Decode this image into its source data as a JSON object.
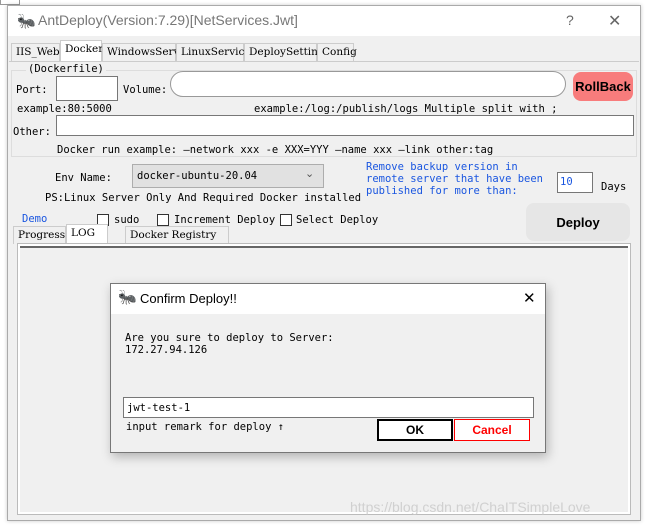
{
  "window": {
    "title": "AntDeploy(Version:7.29)[NetServices.Jwt]",
    "help": "?",
    "close": "✕"
  },
  "tabs": [
    "IIS_Web",
    "Docker",
    "WindowsService",
    "LinuxService",
    "DeploySetting",
    "Config"
  ],
  "dockerfile": {
    "group_label": "(Dockerfile)",
    "port_label": "Port:",
    "port_value": "",
    "volume_label": "Volume:",
    "volume_value": "",
    "port_example": "example:80:5000",
    "volume_example": "example:/log:/publish/logs  Multiple split with ;",
    "other_label": "Other:",
    "other_value": "",
    "run_example": "Docker run example: —network xxx -e XXX=YYY —name xxx —link other:tag"
  },
  "rollback_label": "RollBack",
  "rollback_color": "#f87c7c",
  "env": {
    "label": "Env Name:",
    "selected": "docker-ubuntu-20.04",
    "note": "PS:Linux Server Only And Required Docker installed"
  },
  "backup": {
    "text1": "Remove backup version in",
    "text2": "remote server that have been",
    "text3": "published for more than:",
    "days_value": "10",
    "days_label": "Days"
  },
  "options": {
    "demo": "Demo",
    "sudo": "sudo",
    "increment": "Increment Deploy",
    "select": "Select Deploy"
  },
  "deploy_label": "Deploy",
  "bottom_tabs": [
    "Progress",
    "LOG",
    "Docker Registry"
  ],
  "dialog": {
    "title": "Confirm Deploy!!",
    "message": "Are you sure to deploy to Server:",
    "server": "172.27.94.126",
    "remark_value": "jwt-test-1",
    "remark_hint": "input remark for deploy ↑",
    "ok": "OK",
    "cancel": "Cancel",
    "close": "✕"
  },
  "watermark": "https://blog.csdn.net/ChaITSimpleLove"
}
